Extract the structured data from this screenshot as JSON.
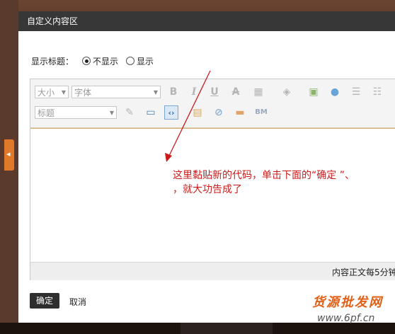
{
  "dialog": {
    "title": "自定义内容区",
    "display_title_label": "显示标题：",
    "options": [
      {
        "label": "不显示",
        "selected": true
      },
      {
        "label": "显示",
        "selected": false
      }
    ]
  },
  "toolbar": {
    "font_size_select": "大小",
    "font_family_select": "字体",
    "heading_select": "标题",
    "buttons": [
      "bold",
      "italic",
      "underline",
      "strikethrough",
      "table",
      "color",
      "image",
      "emoticon",
      "unordered-list",
      "ordered-list",
      "format-painter",
      "media",
      "source-code",
      "flash",
      "embed",
      "divider",
      "bm"
    ]
  },
  "annotation": {
    "line1": "这里黏贴新的代码，单击下面的“确定 ”、",
    "line2": "，就大功告成了"
  },
  "status": {
    "text": "内容正文每5分钟"
  },
  "footer": {
    "ok_label": "确定",
    "cancel_label": "取消"
  },
  "watermark": {
    "main": "货源批发网",
    "url": "www.6pf.cn"
  },
  "colors": {
    "titlebar": "#373737",
    "annotation": "#cc1b1b",
    "accent_tab": "#e07a2a"
  }
}
